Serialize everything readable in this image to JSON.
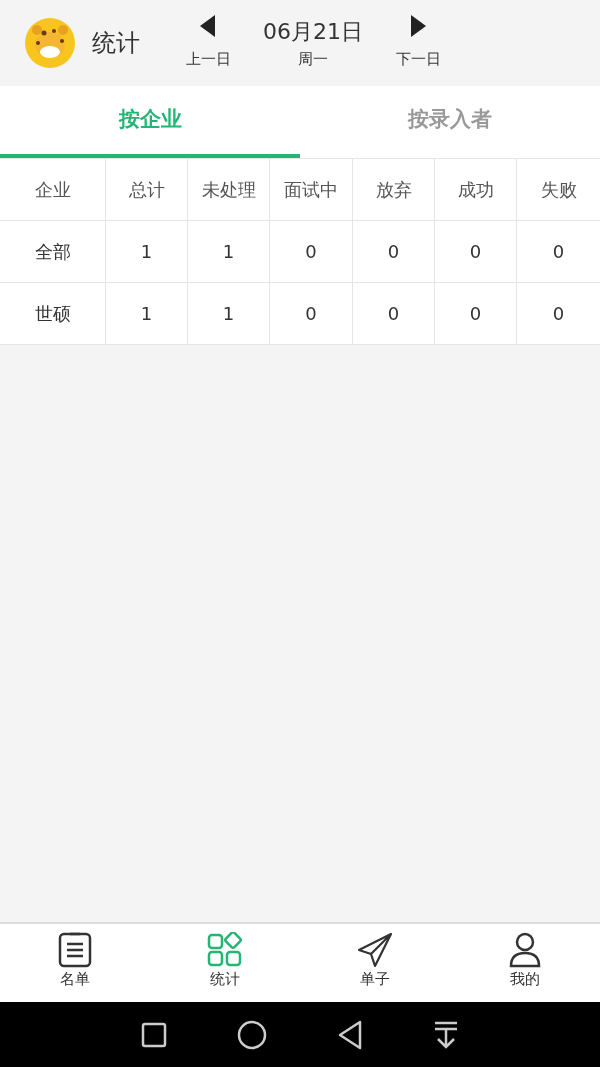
{
  "header": {
    "title": "统计",
    "date": "06月21日",
    "prev_label": "上一日",
    "weekday": "周一",
    "next_label": "下一日"
  },
  "tabs": [
    {
      "label": "按企业",
      "selected": true
    },
    {
      "label": "按录入者",
      "selected": false
    }
  ],
  "table": {
    "columns": [
      "企业",
      "总计",
      "未处理",
      "面试中",
      "放弃",
      "成功",
      "失败"
    ],
    "rows": [
      [
        "全部",
        "1",
        "1",
        "0",
        "0",
        "0",
        "0"
      ],
      [
        "世硕",
        "1",
        "1",
        "0",
        "0",
        "0",
        "0"
      ]
    ]
  },
  "bottom_nav": [
    {
      "kind": "list",
      "label": "名单",
      "selected": false
    },
    {
      "kind": "grid",
      "label": "统计",
      "selected": true
    },
    {
      "kind": "plane",
      "label": "单子",
      "selected": false
    },
    {
      "kind": "person",
      "label": "我的",
      "selected": false
    }
  ]
}
